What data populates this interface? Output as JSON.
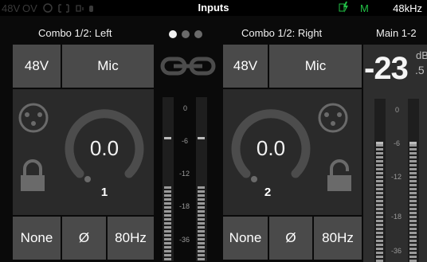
{
  "status_bar": {
    "phantom_label": "48V",
    "overload_label": "OV",
    "title": "Inputs",
    "sync_flag": "M",
    "sample_rate": "48kHz"
  },
  "subheader": {
    "left_channel": "Combo 1/2: Left",
    "right_channel": "Combo 1/2: Right",
    "main_out": "Main 1-2",
    "page_dots": 3,
    "active_dot": 1
  },
  "channel_left": {
    "phantom_button": "48V",
    "source_button": "Mic",
    "gain_value": "0.0",
    "channel_number": "1",
    "filter_none": "None",
    "polarity": "Ø",
    "hpf": "80Hz"
  },
  "channel_right": {
    "phantom_button": "48V",
    "source_button": "Mic",
    "gain_value": "0.0",
    "channel_number": "2",
    "filter_none": "None",
    "polarity": "Ø",
    "hpf": "80Hz"
  },
  "main": {
    "level_big": "-23",
    "level_unit": "dB",
    "level_decimal": ".5"
  },
  "meter_ticks": [
    "0",
    "-6",
    "-12",
    "-18",
    "-36"
  ],
  "colors": {
    "accent": "#22c046",
    "button": "#4a4a4a",
    "panel": "#2a2a2a"
  },
  "icons": [
    "xlr-connector-icon",
    "lock-closed-icon",
    "lock-open-icon",
    "link-chain-icon",
    "lightning-icon"
  ]
}
